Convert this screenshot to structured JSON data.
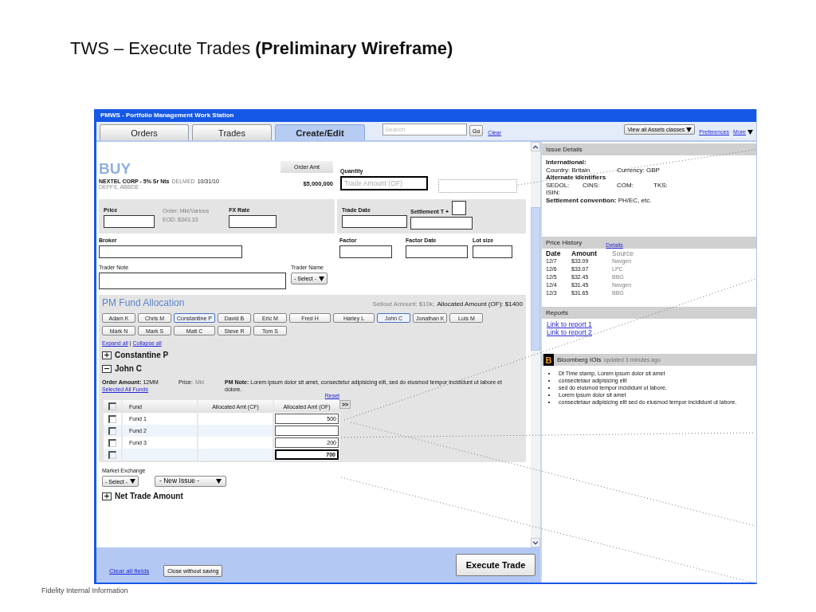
{
  "slide_title": "TWS – Execute Trades **(Preliminary Wireframe)**",
  "window": {
    "title": "PMWS - Portfolio Management Work Station"
  },
  "tabs": [
    {
      "label": "Orders",
      "selected": false
    },
    {
      "label": "Trades",
      "selected": false
    },
    {
      "label": "Create/Edit",
      "selected": true
    }
  ],
  "search": {
    "placeholder": "Search",
    "button": "Go",
    "clear": "Clear"
  },
  "toolbar": {
    "asset_filter": "View all Assets classes",
    "preferences": "Preferences",
    "more": "More"
  },
  "order": {
    "side": "BUY",
    "security": "NEXTEL CORP - 5% Sr Nts",
    "code": "DELMED",
    "date": "10/31/10",
    "ids": "DEFFS, ABBDE",
    "order_amt_label": "Order Amt",
    "order_amt": "$5,000,000",
    "quantity_label": "Quantity",
    "quantity_placeholder": "Trade Amount (OF)"
  },
  "pricing": {
    "price_label": "Price",
    "order_info": "Order: Mkt/Various",
    "eod": "EOD: $343.33",
    "fx_label": "FX Rate",
    "trade_date_label": "Trade Date",
    "settlement_label": "Settlement T +"
  },
  "details": {
    "broker_label": "Broker",
    "factor_label": "Factor",
    "factor_date_label": "Factor Date",
    "lot_size_label": "Lot size",
    "trader_note_label": "Trader Note",
    "trader_name_label": "Trader Name",
    "trader_name_select": "- Select -"
  },
  "allocation": {
    "title": "PM Fund Allocation",
    "sellout": "Sellout Amount: $10k;",
    "allocated": "Allocated Amount (OF): $1400",
    "pm_rows": [
      [
        {
          "name": "Adam K",
          "selected": false
        },
        {
          "name": "Chris M",
          "selected": false
        },
        {
          "name": "Constantine P",
          "selected": true
        },
        {
          "name": "David B",
          "selected": false
        },
        {
          "name": "Eric M",
          "selected": false
        },
        {
          "name": "Fred H",
          "selected": false
        },
        {
          "name": "Harley L",
          "selected": false
        },
        {
          "name": "John C",
          "selected": true
        },
        {
          "name": "Jonathan K",
          "selected": false
        },
        {
          "name": "Luis M",
          "selected": false
        }
      ],
      [
        {
          "name": "Mark N",
          "selected": false
        },
        {
          "name": "Mark S",
          "selected": false
        },
        {
          "name": "Matt C",
          "selected": false
        },
        {
          "name": "Steve R",
          "selected": false
        },
        {
          "name": "Tom S",
          "selected": false
        }
      ]
    ],
    "expand_all": "Expand all",
    "separator": "|",
    "collapse_all": "Collapse all",
    "groups": [
      {
        "name": "Constantine P",
        "expanded": false
      },
      {
        "name": "John C",
        "expanded": true
      }
    ],
    "order_amount": "**Order Amount:** 12MM",
    "select_all": "Selected All Funds",
    "price_label": "Price:",
    "price_value": "Mkt",
    "pm_note": "**PM Note:** Lorem ipsum dolor sit amet, consectetur adipisicing elit, sed do eiusmod tempor incididunt ut labore et dolore.",
    "reset": "Reset",
    "columns": [
      "Fund",
      "Allocated Amt (CF)",
      "Allocated Amt (OF)"
    ],
    "header_checked": false,
    "copy_button": ">>",
    "rows": [
      {
        "fund": "Fund 1",
        "checked": false,
        "amount": "500"
      },
      {
        "fund": "Fund 2",
        "checked": false,
        "amount": ""
      },
      {
        "fund": "Fund 3",
        "checked": false,
        "amount": "200"
      }
    ],
    "total": {
      "checked": false,
      "amount": "700"
    }
  },
  "market": {
    "label": "Market Exchange",
    "select": "- Select -",
    "issue_select": "- New Issue -",
    "net_trade": "Net Trade Amount",
    "net_trade_expanded": false
  },
  "footer": {
    "clear": "Clear all fields",
    "close": "Close without saving",
    "execute": "Execute Trade"
  },
  "issue_details": {
    "title": "Issue Details",
    "international": "International:",
    "country": "Country: Britain",
    "currency": "Currency: GBP",
    "alt_title": "Alternate identifiers",
    "identifiers": [
      "SEDOL:",
      "CINS:",
      "COM:",
      "TKS:"
    ],
    "isin": "ISIN:",
    "settlement": "**Settlement convention:** PH/EC, etc."
  },
  "price_history": {
    "title": "Price History",
    "details": "Details",
    "columns": [
      "Date",
      "Amount",
      "Source"
    ],
    "rows": [
      {
        "date": "12/7",
        "amount": "$33.09",
        "source": "Navgen"
      },
      {
        "date": "12/6",
        "amount": "$33.07",
        "source": "LPC"
      },
      {
        "date": "12/5",
        "amount": "$32.45",
        "source": "BBG"
      },
      {
        "date": "12/4",
        "amount": "$31.45",
        "source": "Navgen"
      },
      {
        "date": "12/3",
        "amount": "$31.65",
        "source": "BBG"
      }
    ]
  },
  "reports": {
    "title": "Reports",
    "links": [
      "Link to report 1",
      "Link to report 2"
    ]
  },
  "bloomberg": {
    "logo": "B",
    "title": "Bloomberg IOIs",
    "updated": "updated 3 minutes ago",
    "items": [
      "Dt Time stamp, Lorem ipsum dolor sit amet",
      "consectetaur adipisicing elit",
      "sed do eiusmod tempor incididunt ut labore.",
      "Lorem ipsum dolor sit amet",
      "consectetaur adipisicing elit sed do eiusmod tempor incididunt ut labore."
    ]
  },
  "slide_footer": "Fidelity Internal Information"
}
